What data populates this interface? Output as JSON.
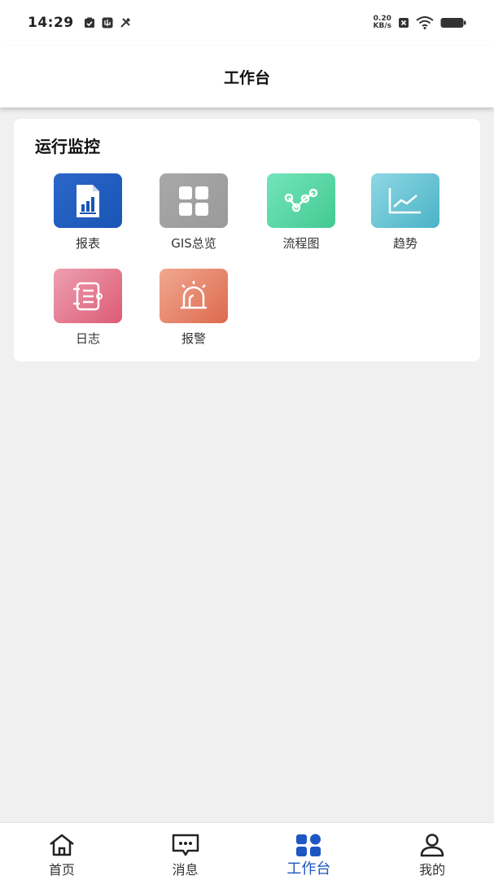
{
  "status_bar": {
    "time": "14:29",
    "left_icons": [
      "shield-check-icon",
      "usb-debug-icon",
      "tools-icon"
    ],
    "net_speed_value": "0.20",
    "net_speed_unit": "KB/s",
    "right_icons": [
      "sim-x-icon",
      "wifi-icon",
      "battery-icon"
    ]
  },
  "header": {
    "title": "工作台"
  },
  "section": {
    "title": "运行监控",
    "tiles": [
      {
        "label": "报表",
        "icon": "report-chart-icon",
        "color_start": "#2a67c9",
        "color_end": "#1a55b4"
      },
      {
        "label": "GIS总览",
        "icon": "grid-icon",
        "color_start": "#a8a8a8",
        "color_end": "#9a9a9a"
      },
      {
        "label": "流程图",
        "icon": "flow-chart-icon",
        "color_start": "#73e5bb",
        "color_end": "#43c991"
      },
      {
        "label": "趋势",
        "icon": "trend-line-icon",
        "color_start": "#8fd7e4",
        "color_end": "#49b3c6"
      },
      {
        "label": "日志",
        "icon": "log-book-icon",
        "color_start": "#ee9fb1",
        "color_end": "#dc5b74"
      },
      {
        "label": "报警",
        "icon": "alarm-light-icon",
        "color_start": "#f0a890",
        "color_end": "#dd6a4e"
      }
    ]
  },
  "bottom_nav": {
    "items": [
      {
        "label": "首页",
        "icon": "home-icon",
        "active": false
      },
      {
        "label": "消息",
        "icon": "message-icon",
        "active": false
      },
      {
        "label": "工作台",
        "icon": "workbench-grid-icon",
        "active": true
      },
      {
        "label": "我的",
        "icon": "user-icon",
        "active": false
      }
    ],
    "active_color": "#1e56c3"
  }
}
